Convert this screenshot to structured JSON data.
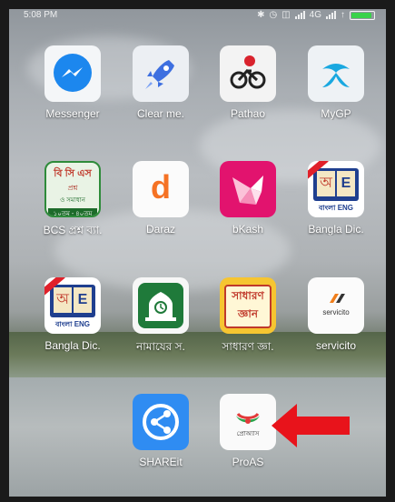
{
  "status_bar": {
    "time": "5:08 PM",
    "network": "4G",
    "battery_level": 0.9,
    "battery_color": "#39d24a"
  },
  "apps": [
    {
      "label": "Messenger",
      "icon": "messenger-icon"
    },
    {
      "label": "Clear me.",
      "icon": "rocket-icon"
    },
    {
      "label": "Pathao",
      "icon": "bicycle-rider-icon"
    },
    {
      "label": "MyGP",
      "icon": "telenor-icon"
    },
    {
      "label": "BCS প্রশ্ন ব্যা.",
      "icon": "bcs-book-icon",
      "tile_text": [
        "বি সি এস",
        "প্রশ্ন",
        "ও সমাধান",
        "১০তম - ৪০তম"
      ]
    },
    {
      "label": "Daraz",
      "icon": "daraz-icon",
      "tile_text": "d"
    },
    {
      "label": "bKash",
      "icon": "bkash-bird-icon"
    },
    {
      "label": "Bangla Dic.",
      "icon": "dictionary-icon",
      "tile_text": [
        "অ",
        "E",
        "বাংলা ENG"
      ]
    },
    {
      "label": "Bangla Dic.",
      "icon": "dictionary-icon",
      "tile_text": [
        "অ",
        "E",
        "বাংলা ENG"
      ]
    },
    {
      "label": "নামাযের স.",
      "icon": "mosque-clock-icon"
    },
    {
      "label": "সাধারণ জ্ঞা.",
      "icon": "general-knowledge-icon",
      "tile_text": [
        "সাধারণ",
        "জ্ঞান"
      ]
    },
    {
      "label": "servicito",
      "icon": "servicito-icon",
      "tile_text": "servicito"
    },
    {
      "label": "SHAREit",
      "icon": "shareit-icon"
    },
    {
      "label": "ProAS",
      "icon": "proas-icon",
      "tile_text": "প্রোঅ্যাস"
    }
  ],
  "colors": {
    "messenger": "#1c87ee",
    "bkash": "#e2136e",
    "shareit": "#2f8cf2",
    "namaz": "#1f7a3a",
    "arrow": "#e8131b"
  }
}
